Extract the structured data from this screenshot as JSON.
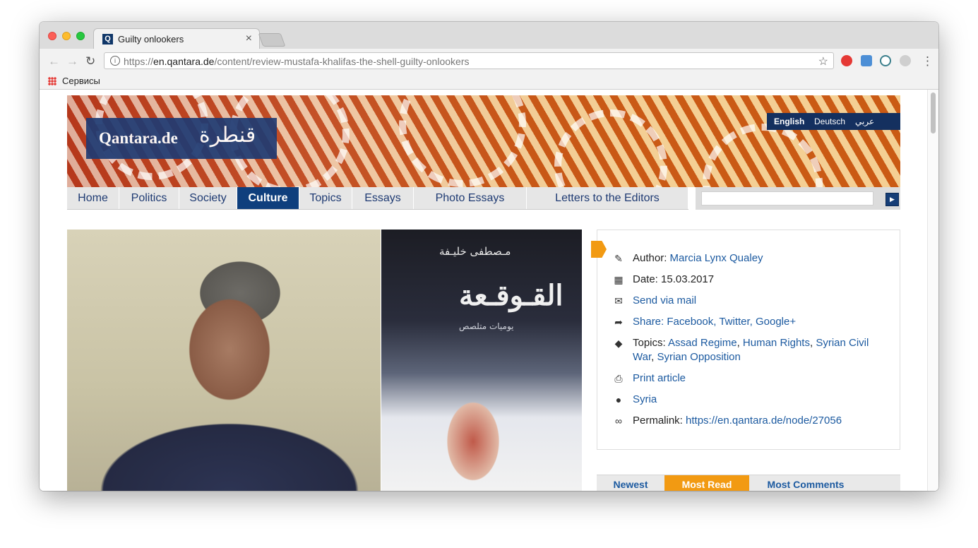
{
  "browser": {
    "tab_title": "Guilty onlookers",
    "tab_favicon": "Q",
    "url_scheme": "https://",
    "url_host": "en.qantara.de",
    "url_path": "/content/review-mustafa-khalifas-the-shell-guilty-onlookers",
    "bookmark_label": "Сервисы"
  },
  "site": {
    "logo_en": "Qantara.de",
    "logo_ar": "قنطرة",
    "languages": [
      "English",
      "Deutsch",
      "عربي"
    ],
    "menu": [
      "Home",
      "Politics",
      "Society",
      "Culture",
      "Topics",
      "Essays",
      "Photo Essays",
      "Letters to the Editors"
    ],
    "active_menu": "Culture"
  },
  "cover": {
    "author_ar": "مـصطفى خليـفة",
    "title_ar": "القـوقـعة",
    "sub_ar": "يوميات متلصص"
  },
  "article_info": {
    "author_label": "Author:",
    "author": "Marcia Lynx Qualey",
    "date_label": "Date:",
    "date": "15.03.2017",
    "send_mail": "Send via mail",
    "share_label": "Share:",
    "share": "Facebook, Twitter, Google+",
    "topics_label": "Topics:",
    "topics_line1": [
      "Assad Regime",
      "Human Rights",
      "Syrian Civil"
    ],
    "topics_line2": [
      "War",
      "Syrian Opposition"
    ],
    "print": "Print article",
    "country": "Syria",
    "permalink_label": "Permalink:",
    "permalink": "https://en.qantara.de/node/27056"
  },
  "sidebar_tabs": [
    "Newest",
    "Most Read",
    "Most Comments"
  ],
  "colors": {
    "brand_blue": "#0f3f7d",
    "accent_orange": "#f29a12",
    "link_blue": "#1c5aa0"
  }
}
